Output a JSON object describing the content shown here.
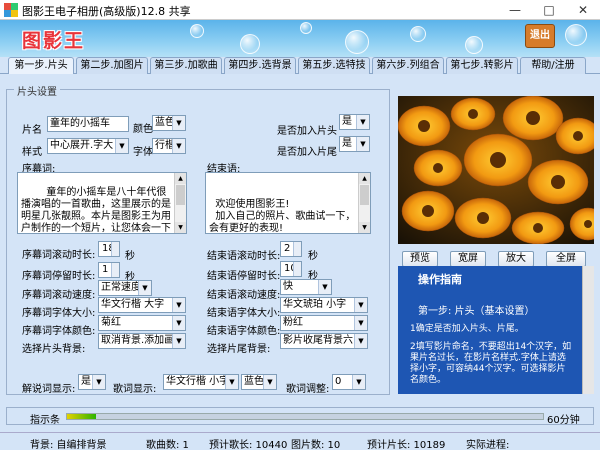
{
  "window": {
    "title": "图影王电子相册(高级版)12.8 共享",
    "minimize": "—",
    "maximize": "□",
    "close": "✕"
  },
  "banner": {
    "logo": "图影王",
    "exit_label": "退出"
  },
  "tabs": [
    {
      "label": "第一步.片头",
      "active": true
    },
    {
      "label": "第二步.加图片",
      "active": false
    },
    {
      "label": "第三步.加歌曲",
      "active": false
    },
    {
      "label": "第四步.选背景",
      "active": false
    },
    {
      "label": "第五步.选特技",
      "active": false
    },
    {
      "label": "第六步.列组合",
      "active": false
    },
    {
      "label": "第七步.转影片",
      "active": false
    },
    {
      "label": "帮助/注册",
      "active": false
    }
  ],
  "settings": {
    "group_label": "片头设置",
    "title_label": "片名",
    "title_value": "童年的小摇车",
    "color_label": "颜色",
    "color_value": "蓝色",
    "style_label": "样式",
    "style_value": "中心展开.字大",
    "font_label": "字体",
    "font_value": "行楷",
    "add_intro_label": "是否加入片头",
    "add_intro_value": "是",
    "add_outro_label": "是否加入片尾",
    "add_outro_value": "是",
    "preface_label": "序幕词:",
    "preface_text": "      童年的小摇车是八十年代很播演唱的一首歌曲，这里展示的是明星几张靓照。本片是图影王为用户制作的一个短片，让您体会一下图影王的制作效果，你可以自己制作大量的家庭",
    "ending_label": "结束语:",
    "ending_text": "\n  欢迎使用图影王!\n  加入自己的照片、歌曲试一下，会有更好的表现!",
    "rows_left": [
      {
        "label": "序幕词滚动时长:",
        "value": "18",
        "unit": "秒",
        "kind": "spin"
      },
      {
        "label": "序幕词停留时长:",
        "value": "1",
        "unit": "秒",
        "kind": "spin"
      },
      {
        "label": "序幕词滚动速度:",
        "value": "正常速度",
        "kind": "select"
      },
      {
        "label": "序幕词字体大小:",
        "value": "华文行楷 大字",
        "kind": "select"
      },
      {
        "label": "序幕词字体颜色:",
        "value": "菊红",
        "kind": "select"
      },
      {
        "label": "选择片头背景:",
        "value": "取消背景.添加画体",
        "kind": "select"
      }
    ],
    "rows_right": [
      {
        "label": "结束语滚动时长:",
        "value": "2",
        "unit": "秒",
        "kind": "spin"
      },
      {
        "label": "结束语停留时长:",
        "value": "10",
        "unit": "秒",
        "kind": "spin"
      },
      {
        "label": "结束语滚动速度:",
        "value": "快",
        "kind": "select"
      },
      {
        "label": "结束语字体大小:",
        "value": "华文琥珀 小字",
        "kind": "select"
      },
      {
        "label": "结束语字体颜色:",
        "value": "粉红",
        "kind": "select"
      },
      {
        "label": "选择片尾背景:",
        "value": "影片收尾背景六",
        "kind": "select"
      }
    ],
    "narration_label": "解说词显示:",
    "narration_value": "是",
    "lyrics_label": "歌词显示:",
    "lyrics_font_value": "华文行楷 小字",
    "lyrics_color_value": "蓝色",
    "lyrics_adjust_label": "歌词调整:",
    "lyrics_adjust_value": "0"
  },
  "preview": {
    "buttons": [
      "预览",
      "宽屏",
      "放大",
      "全屏"
    ]
  },
  "help": {
    "title": "操作指南",
    "step": "第一步: 片头（基本设置）",
    "p1": "1确定是否加入片头、片尾。",
    "p2": "2填写影片命名，不要超出14个汉字，如果片名过长，在影片名样式.字体上请选择小字，可容纳44个汉字。可选择影片名颜色。"
  },
  "progress": {
    "label": "指示条",
    "end_label": "60分钟",
    "fill_fraction": 0.06
  },
  "status": {
    "background": "背景: 自编排背景",
    "songs": "歌曲数: 1",
    "song_len": "预计歌长: 10440",
    "pics": "图片数: 10",
    "film_len": "预计片长: 10189",
    "progress": "实际进程:"
  },
  "colors": {
    "accent": "#1e56b3",
    "logo_red": "#e8343a",
    "banner_blue": "#5bb3ea"
  }
}
